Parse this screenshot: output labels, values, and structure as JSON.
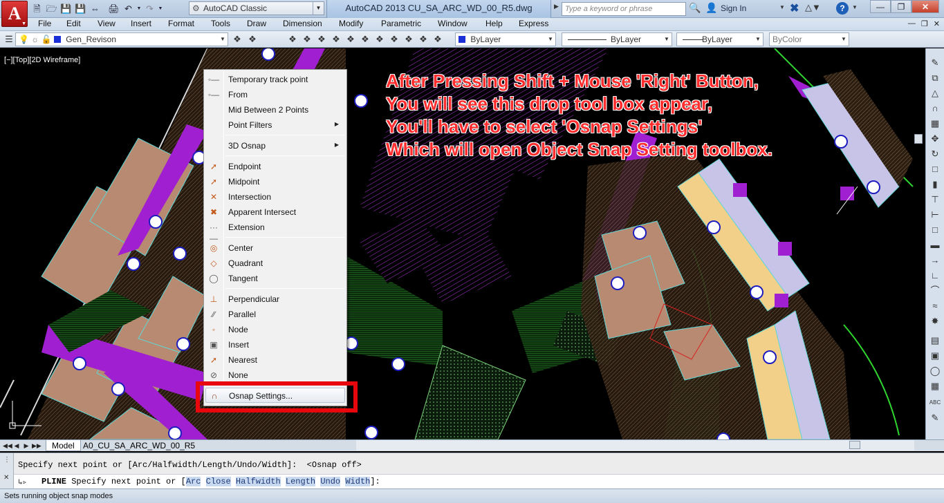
{
  "titlebar": {
    "workspace": "AutoCAD Classic",
    "doc_title": "AutoCAD 2013    CU_SA_ARC_WD_00_R5.dwg",
    "search_placeholder": "Type a keyword or phrase",
    "signin": "Sign In"
  },
  "menubar": [
    "File",
    "Edit",
    "View",
    "Insert",
    "Format",
    "Tools",
    "Draw",
    "Dimension",
    "Modify",
    "Parametric",
    "Window",
    "Help",
    "Express"
  ],
  "toolbar": {
    "layer": "Gen_Revison",
    "color": "ByLayer",
    "linetype": "ByLayer",
    "lineweight": "ByLayer",
    "plotstyle": "ByColor"
  },
  "viewport": {
    "label": "[−][Top][2D Wireframe]"
  },
  "annotation": {
    "lines": [
      "After Pressing Shift + Mouse 'Right' Button,",
      "You will see this drop tool box appear,",
      "You'll have to select 'Osnap Settings'",
      "Which will open Object Snap Setting toolbox."
    ],
    "color": "#ff2d2d"
  },
  "context_menu": {
    "items": [
      {
        "label": "Temporary track point",
        "icon": "temporary-track-point-icon"
      },
      {
        "label": "From",
        "icon": "from-icon"
      },
      {
        "label": "Mid Between 2 Points",
        "icon": ""
      },
      {
        "label": "Point Filters",
        "icon": "",
        "submenu": true
      },
      {
        "label": "3D Osnap",
        "icon": "",
        "submenu": true
      },
      {
        "label": "Endpoint",
        "icon": "endpoint-icon"
      },
      {
        "label": "Midpoint",
        "icon": "midpoint-icon"
      },
      {
        "label": "Intersection",
        "icon": "intersection-icon"
      },
      {
        "label": "Apparent Intersect",
        "icon": "apparent-intersect-icon"
      },
      {
        "label": "Extension",
        "icon": "extension-icon"
      },
      {
        "label": "Center",
        "icon": "center-icon"
      },
      {
        "label": "Quadrant",
        "icon": "quadrant-icon"
      },
      {
        "label": "Tangent",
        "icon": "tangent-icon"
      },
      {
        "label": "Perpendicular",
        "icon": "perpendicular-icon"
      },
      {
        "label": "Parallel",
        "icon": "parallel-icon"
      },
      {
        "label": "Node",
        "icon": "node-icon"
      },
      {
        "label": "Insert",
        "icon": "insert-icon"
      },
      {
        "label": "Nearest",
        "icon": "nearest-icon"
      },
      {
        "label": "None",
        "icon": "none-icon"
      },
      {
        "label": "Osnap Settings...",
        "icon": "osnap-settings-icon",
        "highlighted": true
      }
    ],
    "highlight_color": "#e8070d"
  },
  "tabs": [
    "Model",
    "A0_CU_SA_ARC_WD_00_R5"
  ],
  "command": {
    "history": "Specify next point or [Arc/Halfwidth/Length/Undo/Width]:  <Osnap off>",
    "current_prefix": "PLINE",
    "current_text": "Specify next point or [",
    "options": [
      "Arc",
      "Close",
      "Halfwidth",
      "Length",
      "Undo",
      "Width"
    ],
    "suffix": "]:"
  },
  "status": {
    "text": "Sets running object snap modes"
  }
}
